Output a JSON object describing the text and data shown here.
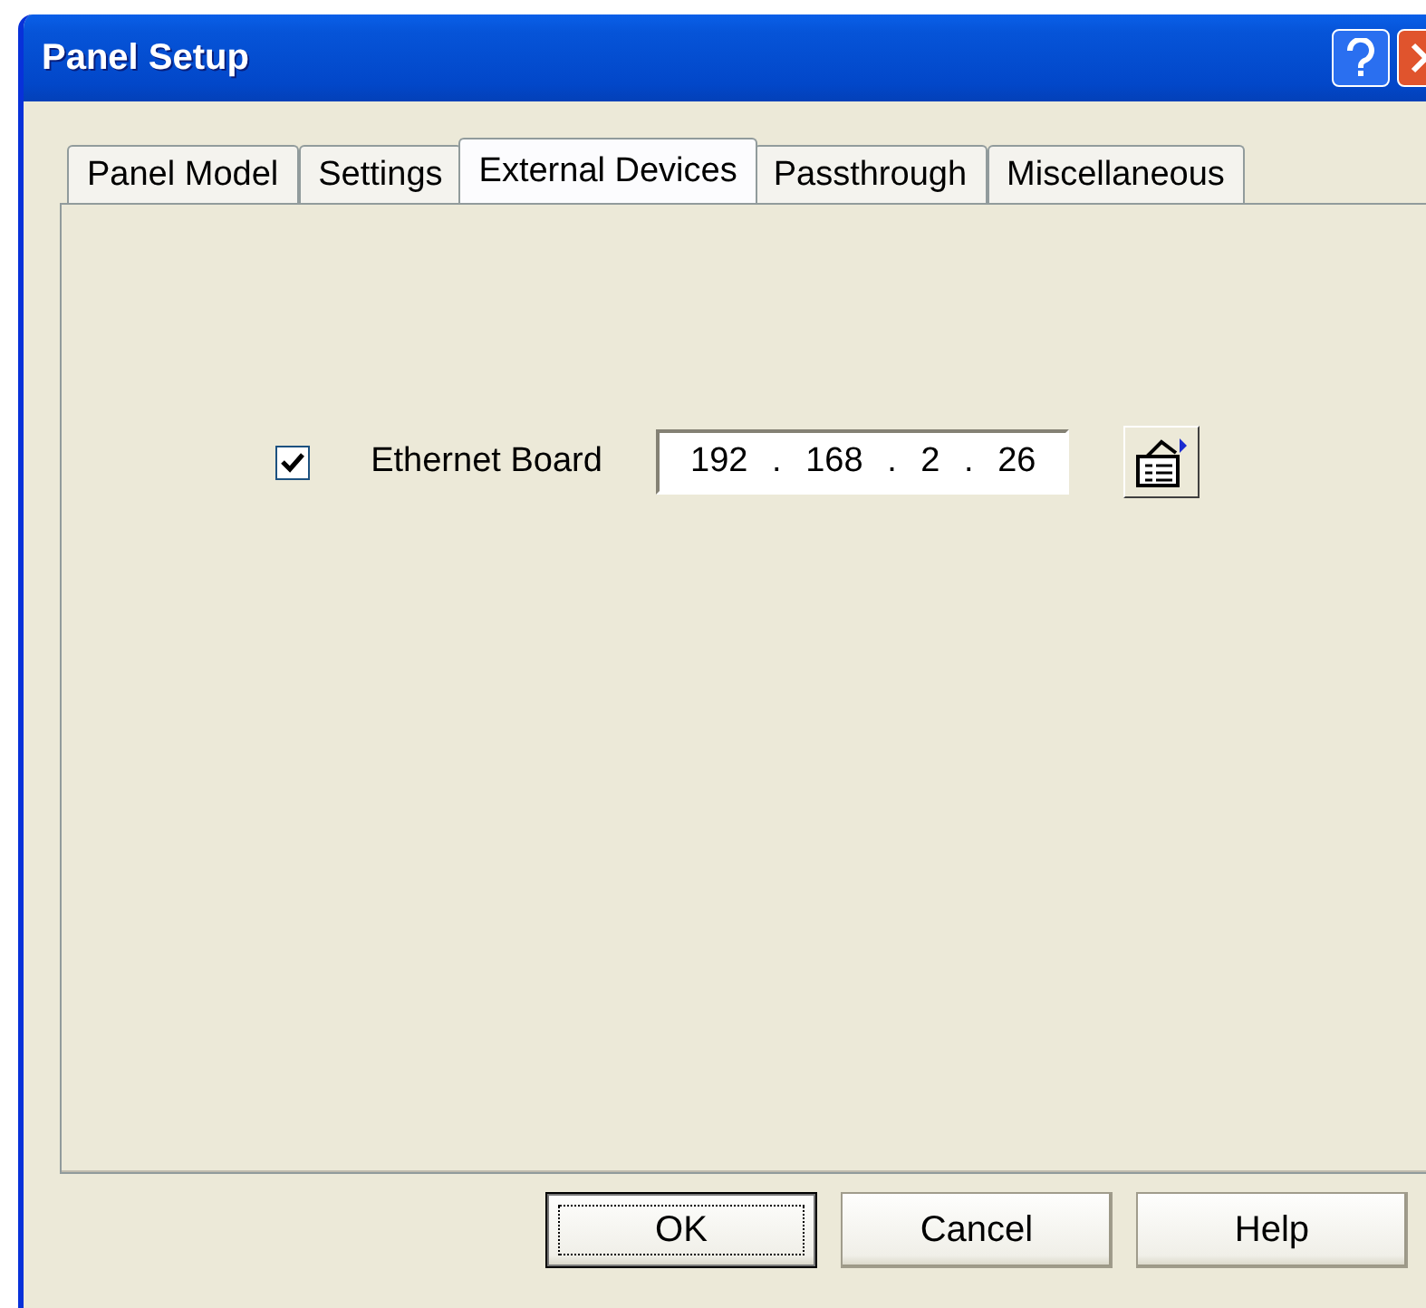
{
  "window": {
    "title": "Panel Setup"
  },
  "tabs": [
    {
      "label": "Panel Model",
      "selected": false
    },
    {
      "label": "Settings",
      "selected": false
    },
    {
      "label": "External Devices",
      "selected": true
    },
    {
      "label": "Passthrough",
      "selected": false
    },
    {
      "label": "Miscellaneous",
      "selected": false
    }
  ],
  "ethernet_board": {
    "label": "Ethernet Board",
    "checked": true,
    "ip_address": [
      "192",
      ".",
      "168",
      ".",
      "2",
      ".",
      "26"
    ]
  },
  "buttons": [
    {
      "label": "OK",
      "default": true
    },
    {
      "label": "Cancel",
      "default": false
    },
    {
      "label": "Help",
      "default": false
    }
  ]
}
